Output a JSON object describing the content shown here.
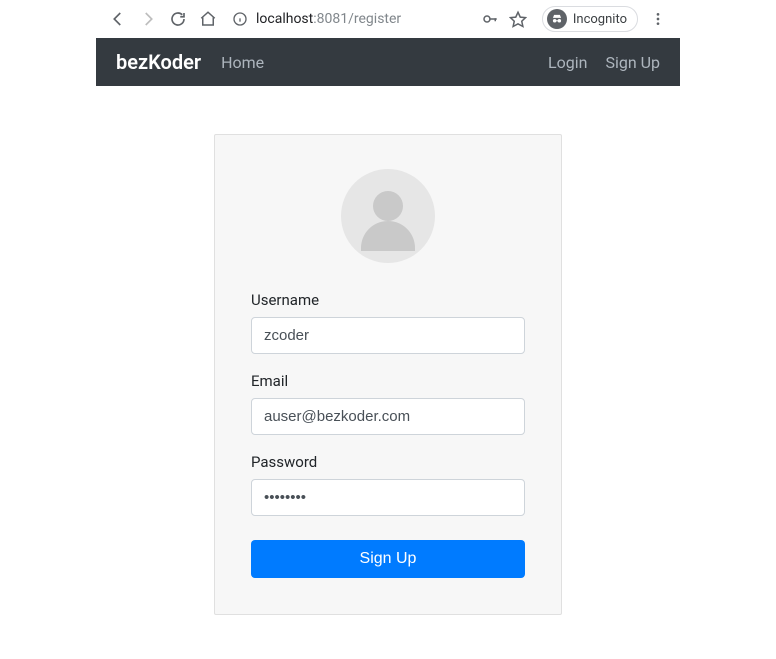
{
  "browser": {
    "url_display": "localhost:8081/register",
    "url_host": "localhost",
    "url_port_path": ":8081/register",
    "incognito_label": "Incognito"
  },
  "navbar": {
    "brand": "bezKoder",
    "links": {
      "home": "Home",
      "login": "Login",
      "signup": "Sign Up"
    }
  },
  "form": {
    "username": {
      "label": "Username",
      "value": "zcoder"
    },
    "email": {
      "label": "Email",
      "value": "auser@bezkoder.com"
    },
    "password": {
      "label": "Password",
      "value": "••••••••"
    },
    "submit_label": "Sign Up"
  },
  "colors": {
    "navbar_bg": "#343a40",
    "primary": "#007bff",
    "card_bg": "#f7f7f7"
  }
}
